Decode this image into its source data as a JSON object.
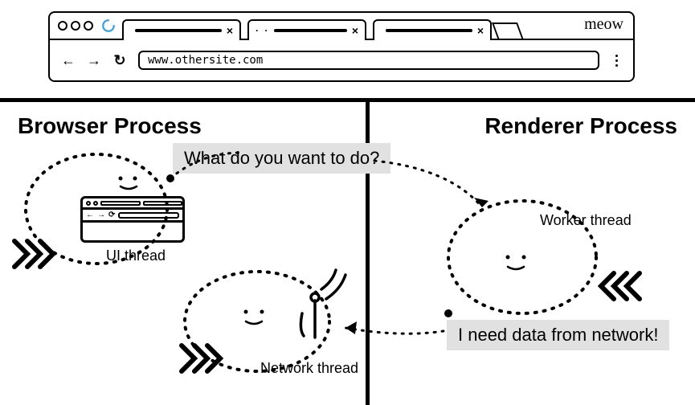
{
  "browser": {
    "meow": "meow",
    "url": "www.othersite.com"
  },
  "processes": {
    "browser": {
      "title": "Browser Process",
      "ui_thread_label": "UI thread",
      "network_thread_label": "Network thread"
    },
    "renderer": {
      "title": "Renderer Process",
      "worker_thread_label": "Worker thread"
    }
  },
  "speech": {
    "question": "What do you want to do?",
    "answer": "I need data from network!"
  }
}
